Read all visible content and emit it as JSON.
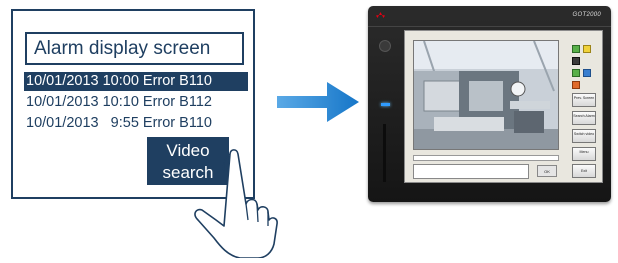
{
  "alarm_screen": {
    "title": "Alarm display screen",
    "rows": [
      {
        "text": "10/01/2013 10:00 Error B110",
        "selected": true
      },
      {
        "text": "10/01/2013 10:10 Error B112",
        "selected": false
      },
      {
        "text": "10/01/2013   9:55 Error B110",
        "selected": false
      }
    ],
    "video_search_button": {
      "line1": "Video",
      "line2": "search"
    }
  },
  "hmi": {
    "model_label": "GOT2000",
    "side_buttons": [
      "Prev. Screen",
      "Search Alarm",
      "Switch video",
      "Menu",
      "Exit"
    ],
    "ok_label": "OK"
  },
  "colors": {
    "navy": "#1f3f61",
    "arrow_blue": "#1676c8",
    "led_blue": "#2f9bff"
  }
}
